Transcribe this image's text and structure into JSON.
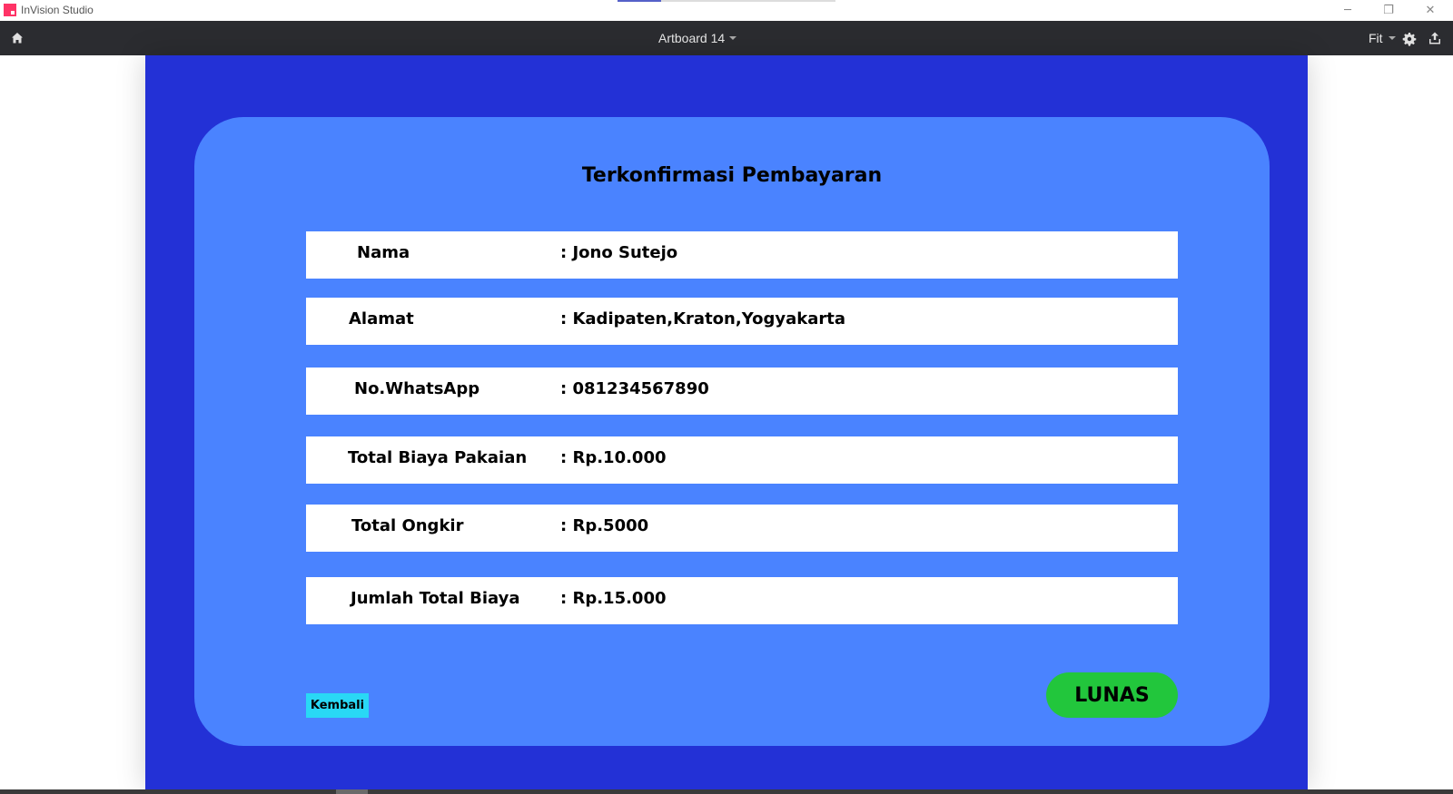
{
  "window": {
    "app_title": "InVision Studio",
    "title_progress": 0.2,
    "controls": {
      "minimize": "─",
      "maximize": "❐",
      "close": "✕"
    }
  },
  "toolbar": {
    "artboard_name": "Artboard 14",
    "zoom_label": "Fit",
    "icons": [
      "home-icon",
      "gear-icon",
      "share-icon"
    ]
  },
  "colors": {
    "artboard_bg": "#2331d6",
    "card_bg": "#4a83ff",
    "row_bg": "#ffffff",
    "back_button": "#29d8f5",
    "lunas_button": "#22c63c"
  },
  "card": {
    "title": "Terkonfirmasi Pembayaran",
    "rows": [
      {
        "label": "Nama",
        "value": ": Jono Sutejo"
      },
      {
        "label": "Alamat",
        "value": ": Kadipaten,Kraton,Yogyakarta"
      },
      {
        "label": "No.WhatsApp",
        "value": ": 081234567890"
      },
      {
        "label": "Total Biaya Pakaian",
        "value": ": Rp.10.000"
      },
      {
        "label": "Total Ongkir",
        "value": ": Rp.5000"
      },
      {
        "label": "Jumlah Total Biaya",
        "value": ": Rp.15.000"
      }
    ],
    "back_label": "Kembali",
    "lunas_label": "LUNAS"
  }
}
